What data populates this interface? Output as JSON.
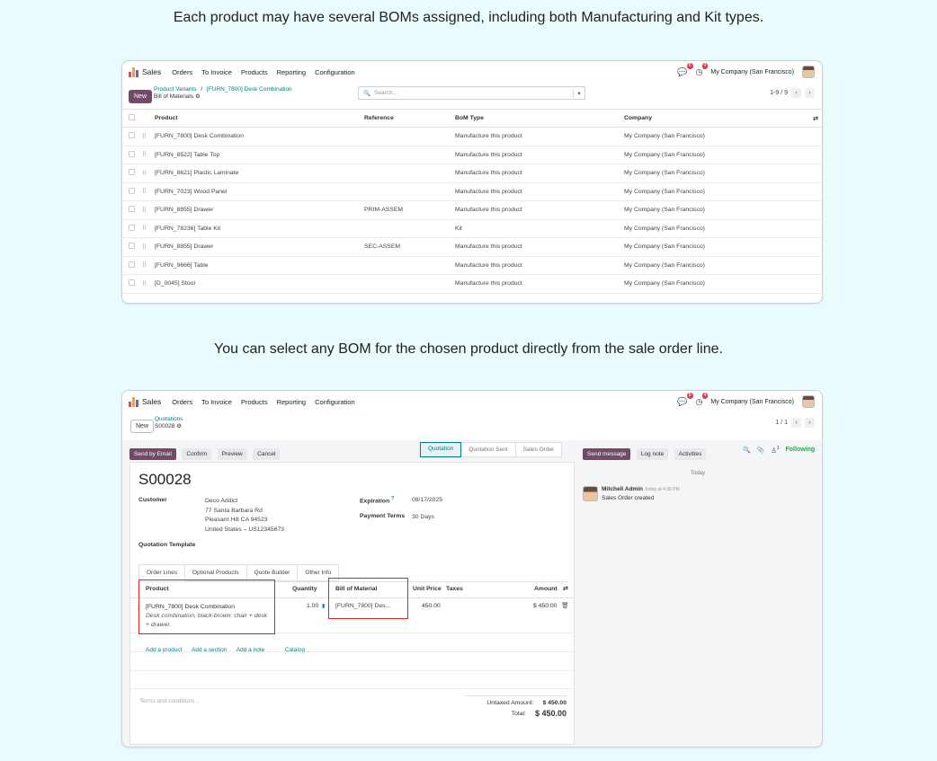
{
  "captions": {
    "top": "Each product may have several BOMs assigned, including both Manufacturing and Kit types.",
    "middle": "You can select any BOM for the chosen product directly from the sale order line."
  },
  "nav": {
    "app": "Sales",
    "menus": [
      "Orders",
      "To Invoice",
      "Products",
      "Reporting",
      "Configuration"
    ],
    "menus2": [
      "Orders",
      "To Invoice",
      "Products",
      "Reporting",
      "Configuration"
    ],
    "chat_badge": "8",
    "activity_badge": "4",
    "company": "My Company (San Francisco)"
  },
  "bom_list": {
    "new_label": "New",
    "breadcrumb_parent": "Product Variants",
    "breadcrumb_sep": "/",
    "breadcrumb_product": "[FURN_7800] Desk Combination",
    "title": "Bill of Materials",
    "search_placeholder": "Search...",
    "pager": "1-9 / 9",
    "columns": [
      "Product",
      "Reference",
      "BoM Type",
      "Company"
    ],
    "rows": [
      {
        "product": "[FURN_7800] Desk Combination",
        "reference": "",
        "type": "Manufacture this product",
        "company": "My Company (San Francisco)"
      },
      {
        "product": "[FURN_8522] Table Top",
        "reference": "",
        "type": "Manufacture this product",
        "company": "My Company (San Francisco)"
      },
      {
        "product": "[FURN_8621] Plastic Laminate",
        "reference": "",
        "type": "Manufacture this product",
        "company": "My Company (San Francisco)"
      },
      {
        "product": "[FURN_7023] Wood Panel",
        "reference": "",
        "type": "Manufacture this product",
        "company": "My Company (San Francisco)"
      },
      {
        "product": "[FURN_8855] Drawer",
        "reference": "PRIM-ASSEM",
        "type": "Manufacture this product",
        "company": "My Company (San Francisco)"
      },
      {
        "product": "[FURN_78236] Table Kit",
        "reference": "",
        "type": "Kit",
        "company": "My Company (San Francisco)"
      },
      {
        "product": "[FURN_8855] Drawer",
        "reference": "SEC-ASSEM",
        "type": "Manufacture this product",
        "company": "My Company (San Francisco)"
      },
      {
        "product": "[FURN_9666] Table",
        "reference": "",
        "type": "Manufacture this product",
        "company": "My Company (San Francisco)"
      },
      {
        "product": "[D_0045] Stool",
        "reference": "",
        "type": "Manufacture this product",
        "company": "My Company (San Francisco)"
      }
    ]
  },
  "quotation": {
    "new_label": "New",
    "breadcrumb_parent": "Quotations",
    "record": "S00028",
    "pager": "1 / 1",
    "actions": [
      "Send by Email",
      "Confirm",
      "Preview",
      "Cancel"
    ],
    "status_steps": [
      "Quotation",
      "Quotation Sent",
      "Sales Order"
    ],
    "title": "S00028",
    "customer_label": "Customer",
    "customer_name": "Deco Addict",
    "address": [
      "77 Santa Barbara Rd",
      "Pleasant Hill CA 94523",
      "United States – US12345673"
    ],
    "expiration_label": "Expiration",
    "expiration_q": "?",
    "expiration": "08/17/2025",
    "payment_label": "Payment Terms",
    "payment_terms": "30 Days",
    "template_label": "Quotation Template",
    "tabs": [
      "Order Lines",
      "Optional Products",
      "Quote Builder",
      "Other Info"
    ],
    "line_columns": {
      "product": "Product",
      "quantity": "Quantity",
      "bom": "Bill of Material",
      "unit_price": "Unit Price",
      "taxes": "Taxes",
      "amount": "Amount"
    },
    "line": {
      "product": "[FURN_7800] Desk Combination",
      "description": "Desk combination, black-brown: chair + desk + drawer.",
      "quantity": "1.00",
      "bom": "[FURN_7800] Des...",
      "unit_price": "450.00",
      "amount": "$ 450.00"
    },
    "add_links": [
      "Add a product",
      "Add a section",
      "Add a note",
      "Catalog"
    ],
    "terms_placeholder": "Terms and conditions...",
    "untaxed_label": "Untaxed Amount:",
    "untaxed": "$ 450.00",
    "total_label": "Total:",
    "total": "$ 450.00"
  },
  "chatter": {
    "send_message": "Send message",
    "log_note": "Log note",
    "activities": "Activities",
    "followers_count": "1",
    "following": "Following",
    "today": "Today",
    "author": "Mitchell Admin",
    "time": "Today at 4:39 PM",
    "message": "Sales Order created"
  },
  "colors": {
    "primary": "#714b67",
    "teal": "#017e84",
    "highlight": "#e02424"
  }
}
